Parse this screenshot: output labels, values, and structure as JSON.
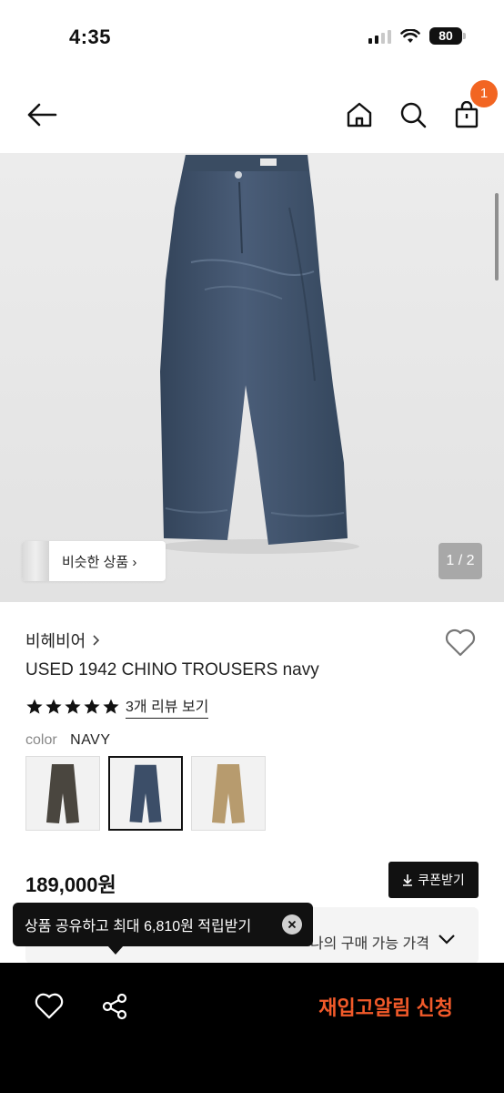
{
  "status_bar": {
    "time": "4:35",
    "battery": "80"
  },
  "header": {
    "cart_count": "1"
  },
  "gallery": {
    "similar_label": "비슷한 상품 ›",
    "counter": "1 / 2"
  },
  "product": {
    "brand": "비헤비어",
    "name": "USED 1942 CHINO TROUSERS navy",
    "rating_stars": 5,
    "review_link": "3개 리뷰 보기",
    "color_label": "color",
    "color_value": "NAVY",
    "swatches": [
      {
        "name": "charcoal",
        "color": "#4a463f",
        "selected": false
      },
      {
        "name": "navy",
        "color": "#3c4e68",
        "selected": true
      },
      {
        "name": "beige",
        "color": "#b79b6e",
        "selected": false
      }
    ],
    "price": "189,000원",
    "coupon_label": "쿠폰받기",
    "best_price_text": "나의 구매 가능 가격"
  },
  "tooltip": {
    "text": "상품 공유하고 최대 6,810원 적립받기"
  },
  "bottom_bar": {
    "restock_label": "재입고알림 신청"
  },
  "colors": {
    "accent": "#f26522",
    "restock": "#f25a2a",
    "pants": "#3d5068"
  }
}
